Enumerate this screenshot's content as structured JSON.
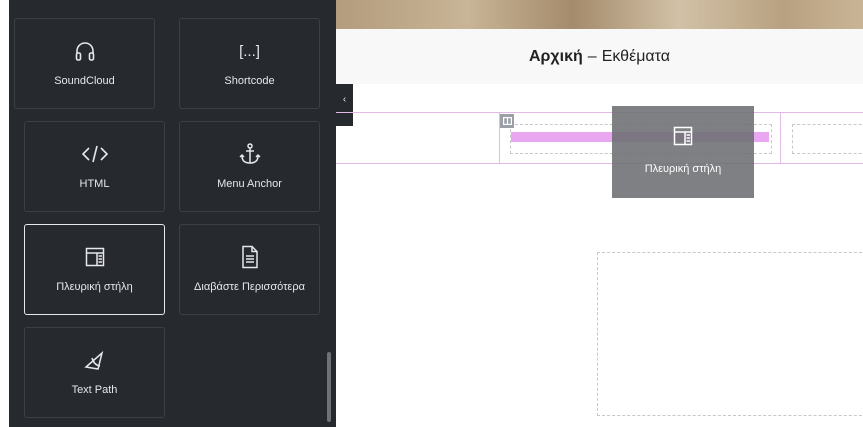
{
  "header": {
    "home": "Αρχική",
    "separator": "–",
    "page": "Εκθέματα"
  },
  "widgets": [
    {
      "label": "SoundCloud",
      "icon": "headphones-icon"
    },
    {
      "label": "Shortcode",
      "icon": "shortcode-icon"
    },
    {
      "label": "HTML",
      "icon": "code-icon"
    },
    {
      "label": "Menu Anchor",
      "icon": "anchor-icon"
    },
    {
      "label": "Πλευρική στήλη",
      "icon": "sidebar-icon",
      "active": true
    },
    {
      "label": "Διαβάστε Περισσότερα",
      "icon": "read-more-icon"
    },
    {
      "label": "Text Path",
      "icon": "text-path-icon"
    }
  ],
  "shortcode_glyph": "[...]",
  "collapse_glyph": "‹",
  "drag_ghost": {
    "label": "Πλευρική στήλη",
    "icon": "sidebar-icon"
  },
  "colors": {
    "panel": "#26292e",
    "drop_indicator": "#e9a6f1",
    "section_outline": "#e3b9e8"
  }
}
